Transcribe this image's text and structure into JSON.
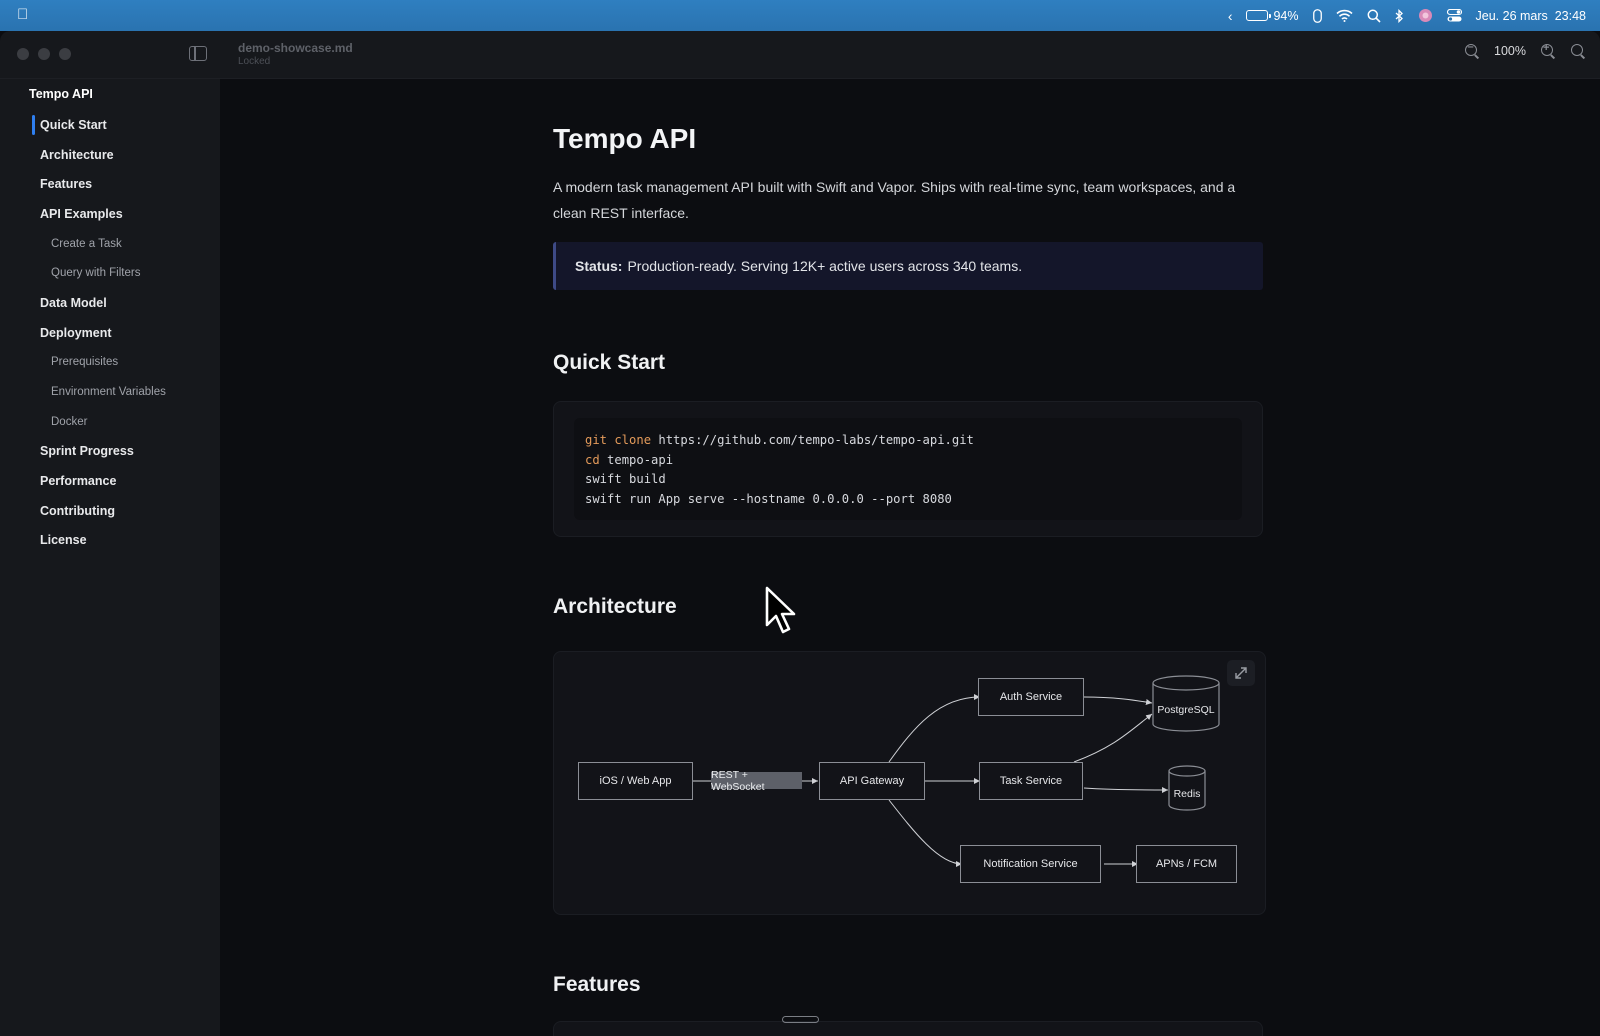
{
  "menubar": {
    "battery_percent": "94%",
    "battery_level": 0.94,
    "datetime": "Jeu. 26 mars  23:48"
  },
  "window": {
    "doc_name": "demo-showcase.md",
    "doc_status": "Locked",
    "zoom_level": "100%"
  },
  "sidebar": {
    "title": "Tempo API",
    "items": [
      {
        "label": "Quick Start",
        "level": 1,
        "active": true
      },
      {
        "label": "Architecture",
        "level": 1
      },
      {
        "label": "Features",
        "level": 1
      },
      {
        "label": "API Examples",
        "level": 1
      },
      {
        "label": "Create a Task",
        "level": 2
      },
      {
        "label": "Query with Filters",
        "level": 2
      },
      {
        "label": "Data Model",
        "level": 1
      },
      {
        "label": "Deployment",
        "level": 1
      },
      {
        "label": "Prerequisites",
        "level": 2
      },
      {
        "label": "Environment Variables",
        "level": 2
      },
      {
        "label": "Docker",
        "level": 2
      },
      {
        "label": "Sprint Progress",
        "level": 1
      },
      {
        "label": "Performance",
        "level": 1
      },
      {
        "label": "Contributing",
        "level": 1
      },
      {
        "label": "License",
        "level": 1
      }
    ]
  },
  "doc": {
    "title": "Tempo API",
    "intro": "A modern task management API built with Swift and Vapor. Ships with real-time sync, team workspaces, and a clean REST interface.",
    "callout_label": "Status:",
    "callout_text": "Production-ready. Serving 12K+ active users across 340 teams.",
    "quick_start_heading": "Quick Start",
    "code_lines": [
      {
        "kw": "git clone",
        "rest": " https://github.com/tempo-labs/tempo-api.git"
      },
      {
        "kw": "cd",
        "rest": " tempo-api"
      },
      {
        "kw": "",
        "rest": "swift build"
      },
      {
        "kw": "",
        "rest": "swift run App serve --hostname 0.0.0.0 --port 8080"
      }
    ],
    "architecture_heading": "Architecture",
    "features_heading": "Features"
  },
  "diagram": {
    "nodes": {
      "client": "iOS / Web App",
      "gateway": "API Gateway",
      "auth": "Auth Service",
      "task": "Task Service",
      "notify": "Notification Service",
      "apns": "APNs / FCM",
      "postgres": "PostgreSQL",
      "redis": "Redis"
    },
    "edge_label": "REST + WebSocket"
  },
  "colors": {
    "accent": "#2f7ff0",
    "keyword": "#e39a5a",
    "background": "#0c0d11"
  }
}
